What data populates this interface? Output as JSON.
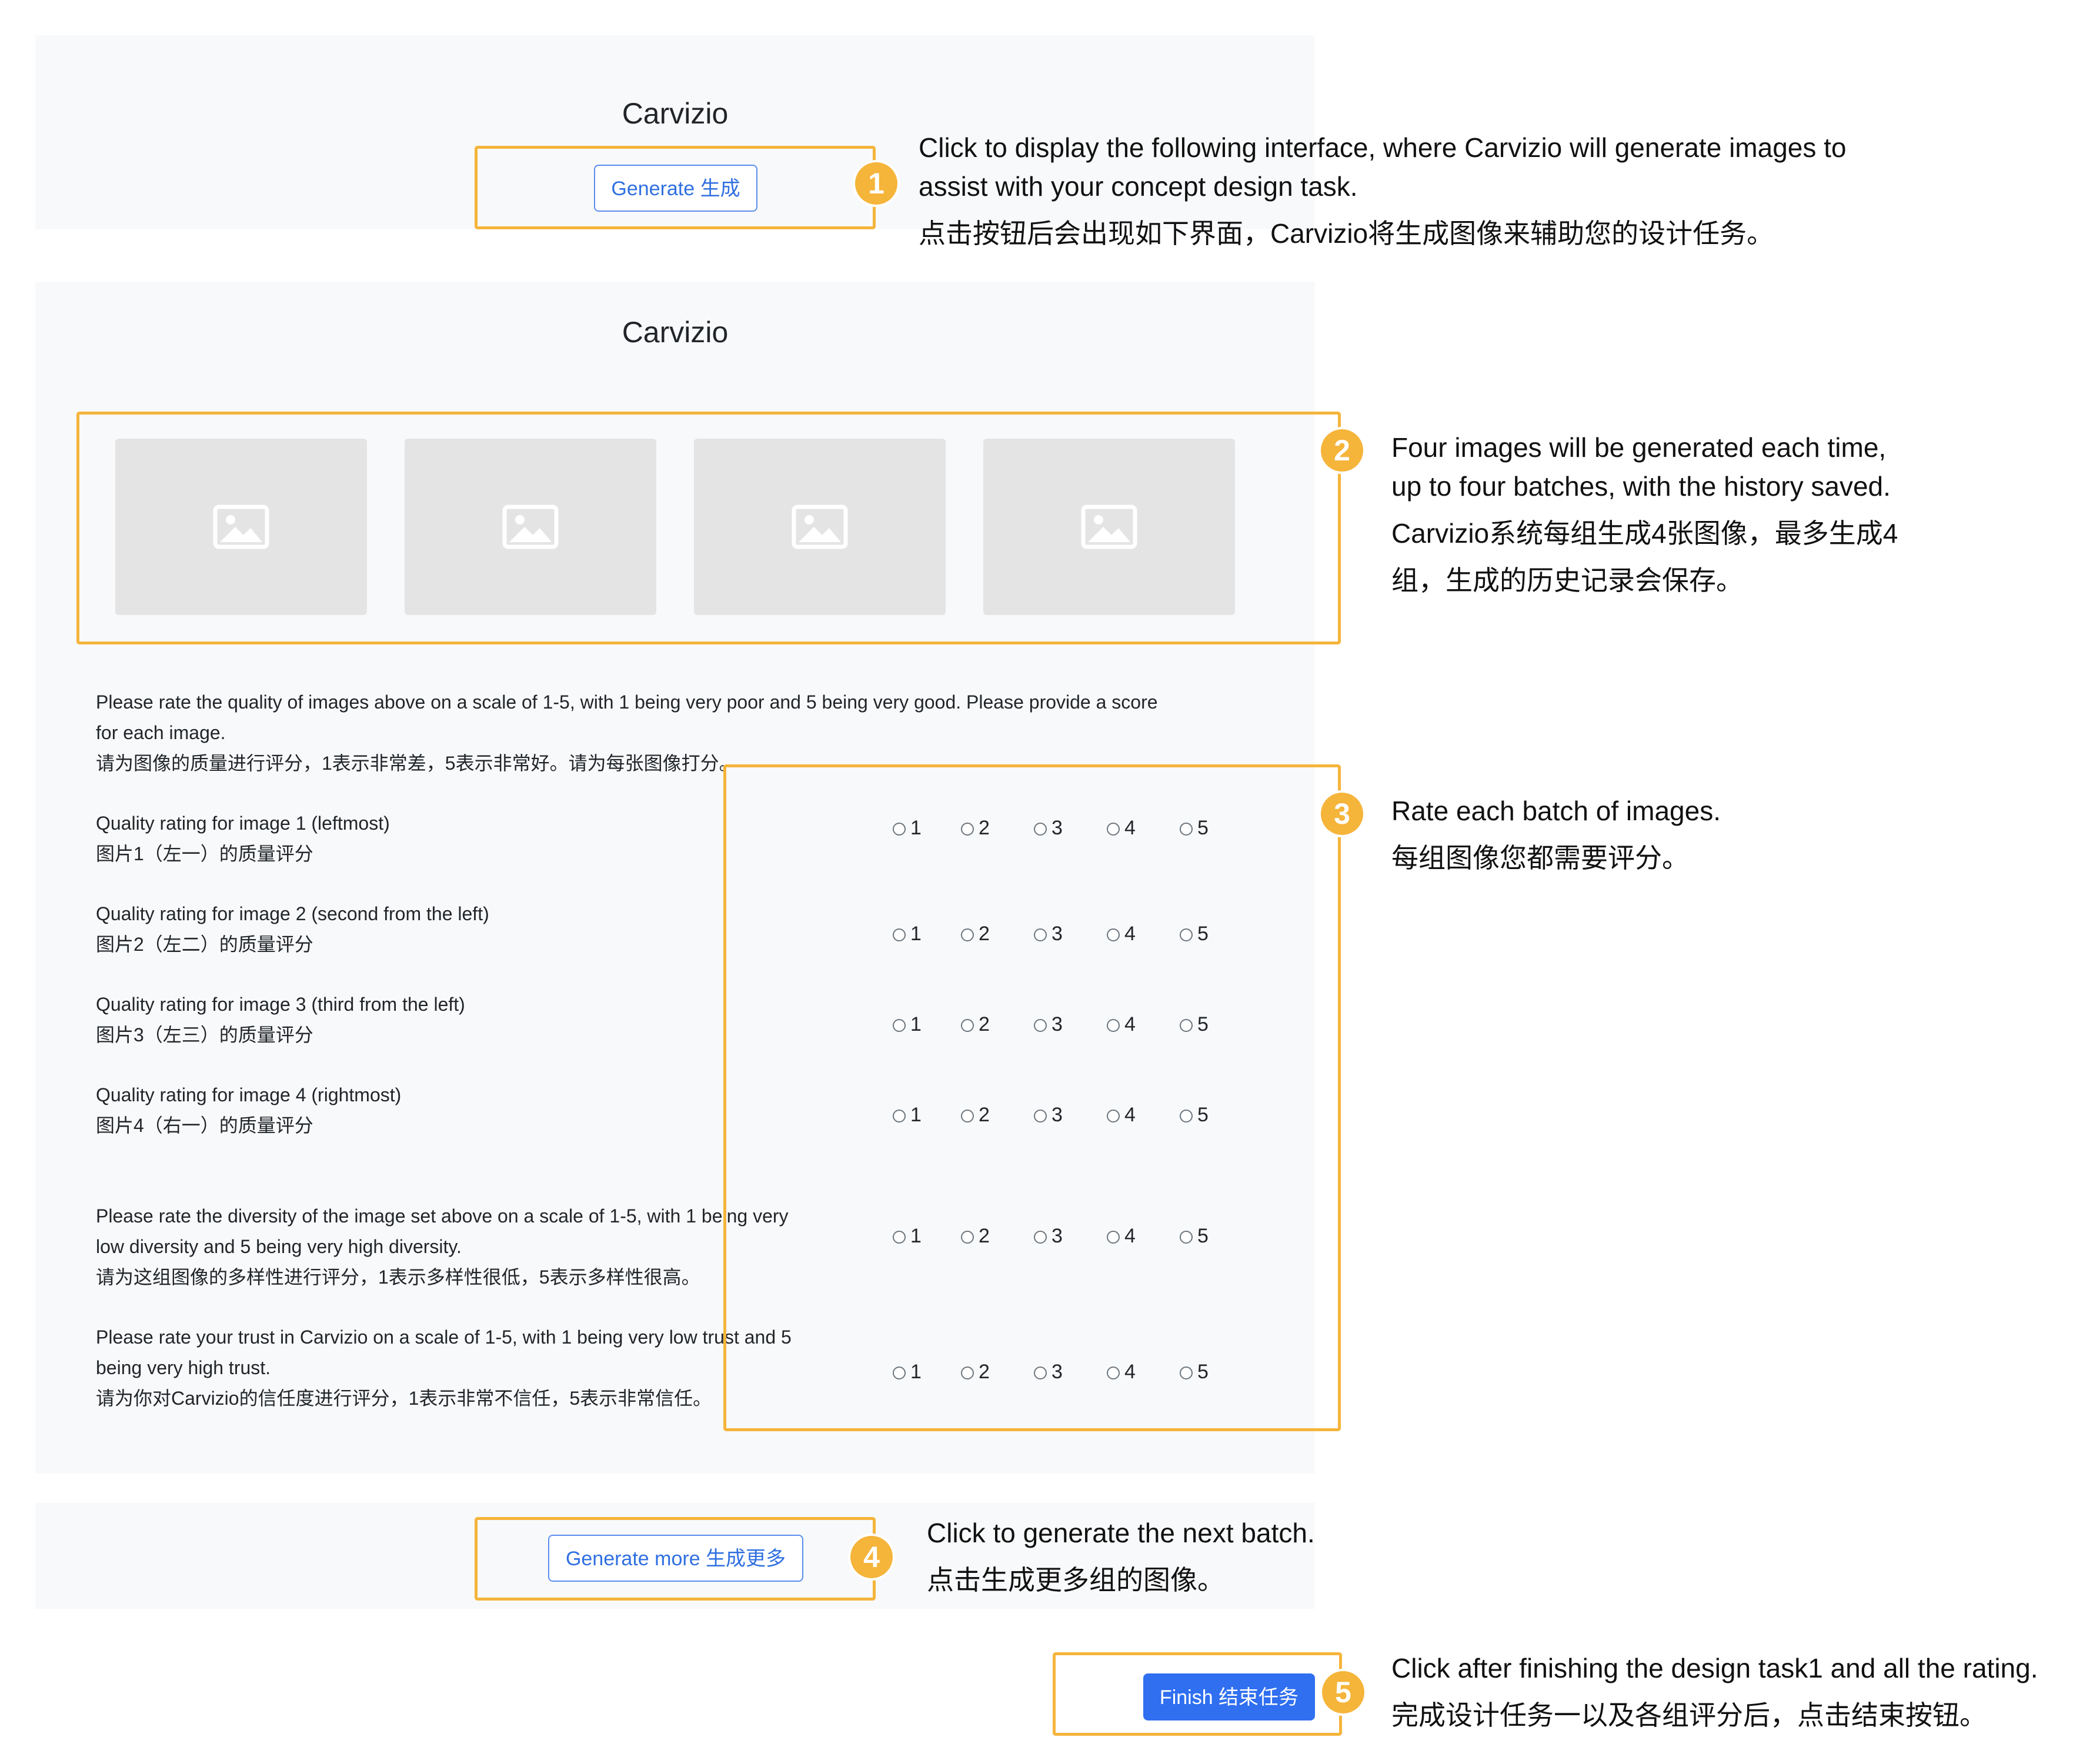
{
  "app": {
    "title": "Carvizio"
  },
  "step1": {
    "badge": "1",
    "button_label": "Generate 生成",
    "callout_en_1": "Click to display the following interface, where Carvizio will generate images to",
    "callout_en_2": "assist with your concept design task.",
    "callout_cn": "点击按钮后会出现如下界面，Carvizio将生成图像来辅助您的设计任务。"
  },
  "step2": {
    "badge": "2",
    "image_count": 4,
    "image_icon": "image-placeholder-icon",
    "callout_en_1": "Four images will be generated each time,",
    "callout_en_2": "up to four batches, with the history saved.",
    "callout_cn_1": "Carvizio系统每组生成4张图像，最多生成4",
    "callout_cn_2": "组，生成的历史记录会保存。"
  },
  "rating": {
    "intro_en_1": "Please rate the quality of images above on a scale of 1-5, with 1 being very poor and 5 being very good. Please provide a score",
    "intro_en_2": "for each image.",
    "intro_cn": "请为图像的质量进行评分，1表示非常差，5表示非常好。请为每张图像打分。",
    "options": [
      "1",
      "2",
      "3",
      "4",
      "5"
    ],
    "q1_en": "Quality rating for image 1 (leftmost)",
    "q1_cn": "图片1（左一）的质量评分",
    "q2_en": "Quality rating for image 2 (second from the left)",
    "q2_cn": "图片2（左二）的质量评分",
    "q3_en": "Quality rating for image 3 (third from the left)",
    "q3_cn": "图片3（左三）的质量评分",
    "q4_en": "Quality rating for image 4 (rightmost)",
    "q4_cn": "图片4（右一）的质量评分",
    "diversity_en_1": "Please rate the diversity of the image set above on a scale of 1-5, with 1 being very",
    "diversity_en_2": "low diversity and 5 being very high diversity.",
    "diversity_cn": "请为这组图像的多样性进行评分，1表示多样性很低，5表示多样性很高。",
    "trust_en_1": "Please rate your trust in Carvizio on a scale of 1-5, with 1 being very low trust and 5",
    "trust_en_2": "being very high trust.",
    "trust_cn": "请为你对Carvizio的信任度进行评分，1表示非常不信任，5表示非常信任。"
  },
  "step3": {
    "badge": "3",
    "callout_en": "Rate each batch of images.",
    "callout_cn": "每组图像您都需要评分。"
  },
  "step4": {
    "badge": "4",
    "button_label": "Generate more 生成更多",
    "callout_en": "Click to generate the next batch.",
    "callout_cn": "点击生成更多组的图像。"
  },
  "step5": {
    "badge": "5",
    "button_label": "Finish 结束任务",
    "callout_en": "Click after finishing the design task1 and all the rating.",
    "callout_cn": "完成设计任务一以及各组评分后，点击结束按钮。"
  },
  "colors": {
    "highlight": "#f5b43a",
    "primary": "#2f6ff0",
    "panel_bg": "#f8f9fa",
    "thumb_bg": "#e4e4e4"
  }
}
